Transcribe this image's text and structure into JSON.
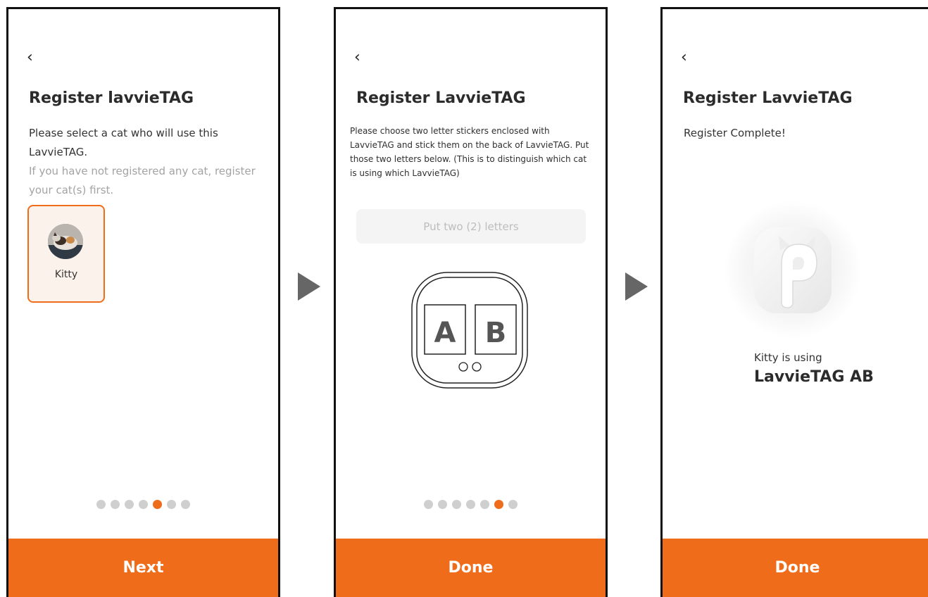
{
  "screens": {
    "select_cat": {
      "title": "Register lavvieTAG",
      "instruction": "Please select a cat who will use this LavvieTAG.",
      "hint": "If you have not registered any cat, register your cat(s) first.",
      "cats": [
        {
          "name": "Kitty",
          "selected": true
        }
      ],
      "pagination": {
        "total": 7,
        "current": 5
      },
      "button_label": "Next"
    },
    "letter_stickers": {
      "title": "Register LavvieTAG",
      "instruction": "Please choose two letter stickers enclosed with LavvieTAG and stick them on the back of LavvieTAG. Put those two letters below. (This is to distinguish which cat is using which LavvieTAG)",
      "input_placeholder": "Put two (2) letters",
      "input_value": "",
      "sticker_letters": [
        "A",
        "B"
      ],
      "pagination": {
        "total": 7,
        "current": 6
      },
      "button_label": "Done"
    },
    "complete": {
      "title": "Register LavvieTAG",
      "message": "Register Complete!",
      "using_text": "Kitty is using",
      "tag_name": "LavvieTAG AB",
      "button_label": "Done"
    }
  },
  "icons": {
    "back": "chevron-left-icon",
    "flow_arrow": "play-arrow-icon"
  },
  "colors": {
    "accent": "#ef6c1a",
    "selected_card_bg": "#fcf2ec",
    "dot_inactive": "#cfcfcf",
    "hint_text": "#a3a3a3",
    "arrow": "#666666"
  }
}
